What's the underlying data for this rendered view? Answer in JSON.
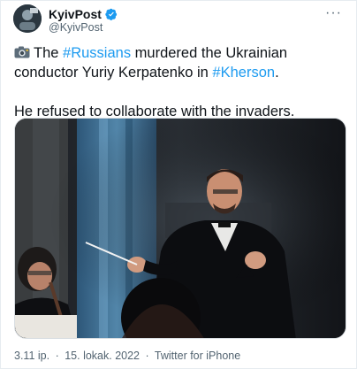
{
  "tweet": {
    "author": {
      "display_name": "KyivPost",
      "handle": "@KyivPost",
      "verified": true,
      "avatar_icon": "kyivpost-logo-avatar"
    },
    "more_label": "···",
    "text": {
      "line1_prefix": "The ",
      "hashtag1": "#Russians",
      "line1_middle": " murdered the Ukrainian conductor Yuriy Kerpatenko in ",
      "hashtag2": "#Kherson",
      "line1_suffix": ".",
      "line2": "He refused to collaborate with the invaders."
    },
    "media": {
      "icon": "photo-of-conductor-on-stage"
    },
    "footer": {
      "time": "3.11 ip.",
      "separator1": "·",
      "date": "15. lokak. 2022",
      "separator2": "·",
      "source": "Twitter for iPhone"
    }
  },
  "colors": {
    "accent": "#1d9bf0",
    "text": "#0f1419",
    "muted": "#536471"
  }
}
